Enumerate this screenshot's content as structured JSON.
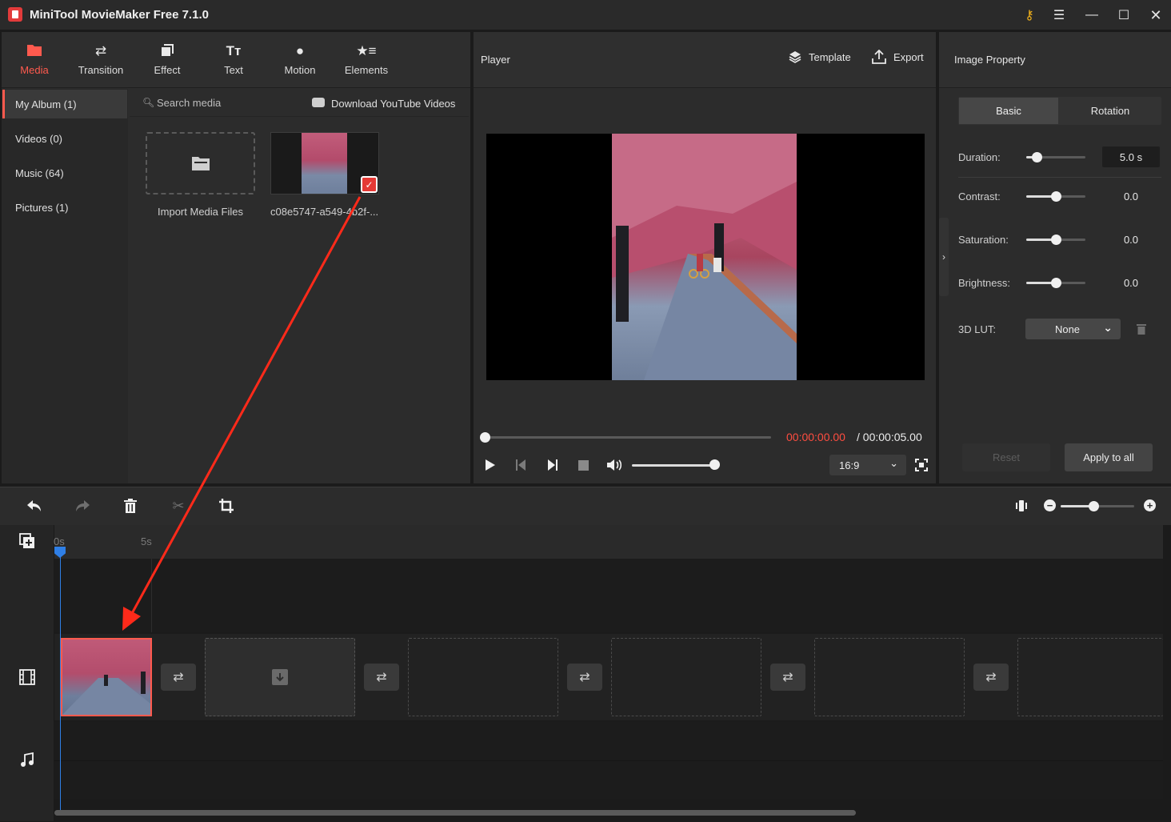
{
  "window": {
    "title": "MiniTool MovieMaker Free 7.1.0"
  },
  "nav": {
    "items": [
      {
        "label": "Media",
        "icon": "folder-icon",
        "active": true
      },
      {
        "label": "Transition",
        "icon": "swap-arrows-icon"
      },
      {
        "label": "Effect",
        "icon": "effect-icon"
      },
      {
        "label": "Text",
        "icon": "text-icon"
      },
      {
        "label": "Motion",
        "icon": "motion-icon"
      },
      {
        "label": "Elements",
        "icon": "elements-icon"
      }
    ]
  },
  "album": {
    "items": [
      {
        "label": "My Album (1)",
        "active": true
      },
      {
        "label": "Videos (0)"
      },
      {
        "label": "Music (64)"
      },
      {
        "label": "Pictures (1)"
      }
    ]
  },
  "media": {
    "search_placeholder": "Search media",
    "download_label": "Download YouTube Videos",
    "import_label": "Import Media Files",
    "file_label": "c08e5747-a549-4b2f-..."
  },
  "player": {
    "title": "Player",
    "template_label": "Template",
    "export_label": "Export",
    "current_time": "00:00:00.00",
    "total_time": "/ 00:00:05.00",
    "aspect": "16:9",
    "progress": 0.0,
    "volume": 1.0
  },
  "property": {
    "title": "Image Property",
    "tabs": [
      "Basic",
      "Rotation"
    ],
    "active_tab": "Basic",
    "rows": [
      {
        "label": "Duration:",
        "value": "5.0 s",
        "level": 0.18
      },
      {
        "label": "Contrast:",
        "value": "0.0",
        "level": 0.5
      },
      {
        "label": "Saturation:",
        "value": "0.0",
        "level": 0.5
      },
      {
        "label": "Brightness:",
        "value": "0.0",
        "level": 0.5
      }
    ],
    "lut_label": "3D LUT:",
    "lut_value": "None",
    "reset_label": "Reset",
    "apply_label": "Apply to all"
  },
  "timeline": {
    "ruler": [
      "0s",
      "5s"
    ],
    "zoom_level": 0.45
  },
  "colors": {
    "accent": "#ff5a4e",
    "playhead": "#2f7fe6",
    "annotation_arrow": "#ff2a1a"
  }
}
